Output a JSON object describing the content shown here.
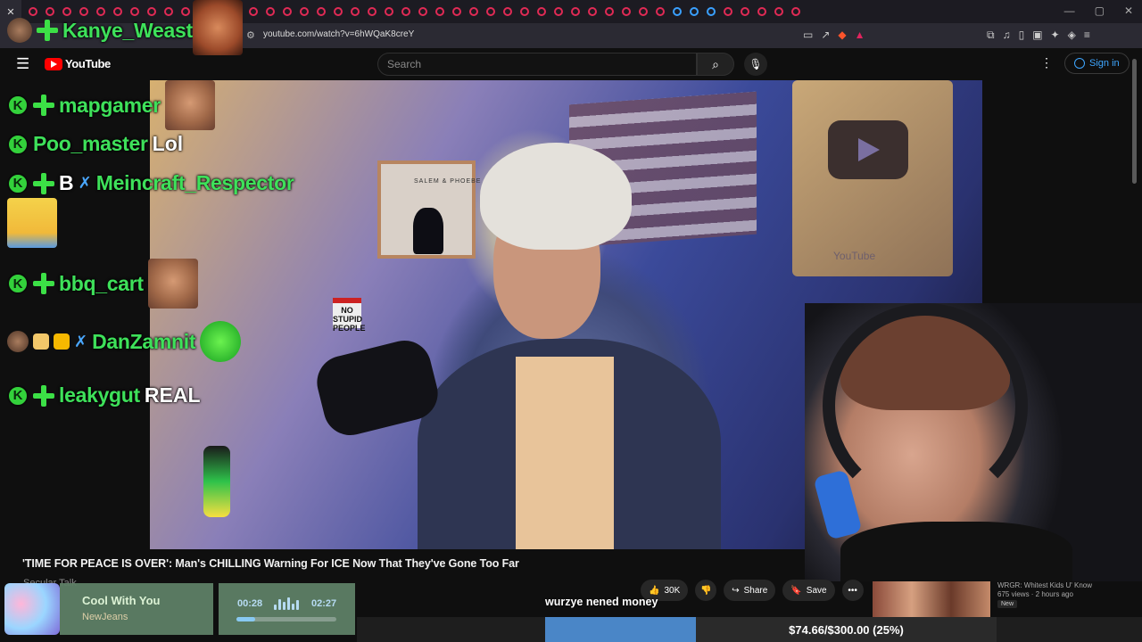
{
  "browser": {
    "url": "youtube.com/watch?v=6hWQaK8creY"
  },
  "youtube": {
    "logo_text": "YouTube",
    "search_placeholder": "Search",
    "signin_label": "Sign in",
    "video_title": "'TIME FOR PEACE IS OVER': Man's CHILLING Warning For ICE Now That They've Gone Too Far",
    "channel_name": "Secular Talk",
    "like_count": "30K",
    "share_label": "Share",
    "save_label": "Save",
    "plaque_text": "YouTube",
    "frame_text": "SALEM & PHOEBE",
    "sign_text": "NO STUPID PEOPLE"
  },
  "recommendation": {
    "title": "WRGR: Whitest Kids U' Know",
    "meta": "675 views · 2 hours ago",
    "badge": "New"
  },
  "chat": {
    "top_user": "Kanye_Weast",
    "messages": [
      {
        "user": "mapgamer",
        "text": ""
      },
      {
        "user": "Poo_master",
        "text": "Lol"
      },
      {
        "user": "Meincraft_Respector",
        "text": "",
        "prefix": "B"
      },
      {
        "user": "bbq_cart",
        "text": ""
      },
      {
        "user": "DanZamnit",
        "text": ""
      },
      {
        "user": "leakygut",
        "text": "REAL"
      }
    ]
  },
  "music": {
    "song": "Cool With You",
    "artist": "NewJeans",
    "current_time": "00:28",
    "total_time": "02:27",
    "progress": 0.19
  },
  "caption": "wurzye nened money",
  "donation_goal": "$74.66/$300.00 (25%)",
  "colors": {
    "chat_username": "#3ee15a",
    "youtube_red": "#ff0000",
    "signin_blue": "#3ea6ff",
    "tab_indicator": "#e02a55"
  }
}
